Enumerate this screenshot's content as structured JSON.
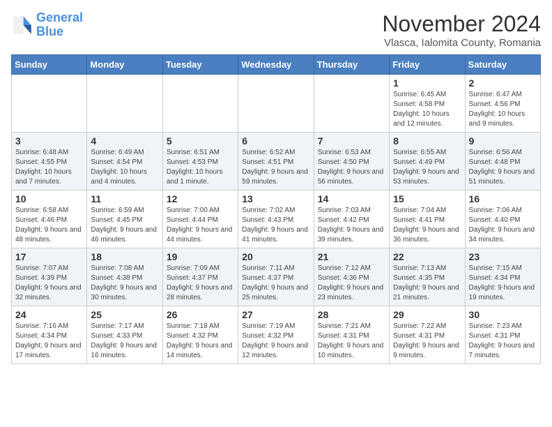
{
  "header": {
    "logo_line1": "General",
    "logo_line2": "Blue",
    "month_title": "November 2024",
    "subtitle": "Vlasca, Ialomita County, Romania"
  },
  "days_of_week": [
    "Sunday",
    "Monday",
    "Tuesday",
    "Wednesday",
    "Thursday",
    "Friday",
    "Saturday"
  ],
  "weeks": [
    [
      {
        "day": "",
        "info": ""
      },
      {
        "day": "",
        "info": ""
      },
      {
        "day": "",
        "info": ""
      },
      {
        "day": "",
        "info": ""
      },
      {
        "day": "",
        "info": ""
      },
      {
        "day": "1",
        "info": "Sunrise: 6:45 AM\nSunset: 4:58 PM\nDaylight: 10 hours and 12 minutes."
      },
      {
        "day": "2",
        "info": "Sunrise: 6:47 AM\nSunset: 4:56 PM\nDaylight: 10 hours and 9 minutes."
      }
    ],
    [
      {
        "day": "3",
        "info": "Sunrise: 6:48 AM\nSunset: 4:55 PM\nDaylight: 10 hours and 7 minutes."
      },
      {
        "day": "4",
        "info": "Sunrise: 6:49 AM\nSunset: 4:54 PM\nDaylight: 10 hours and 4 minutes."
      },
      {
        "day": "5",
        "info": "Sunrise: 6:51 AM\nSunset: 4:53 PM\nDaylight: 10 hours and 1 minute."
      },
      {
        "day": "6",
        "info": "Sunrise: 6:52 AM\nSunset: 4:51 PM\nDaylight: 9 hours and 59 minutes."
      },
      {
        "day": "7",
        "info": "Sunrise: 6:53 AM\nSunset: 4:50 PM\nDaylight: 9 hours and 56 minutes."
      },
      {
        "day": "8",
        "info": "Sunrise: 6:55 AM\nSunset: 4:49 PM\nDaylight: 9 hours and 53 minutes."
      },
      {
        "day": "9",
        "info": "Sunrise: 6:56 AM\nSunset: 4:48 PM\nDaylight: 9 hours and 51 minutes."
      }
    ],
    [
      {
        "day": "10",
        "info": "Sunrise: 6:58 AM\nSunset: 4:46 PM\nDaylight: 9 hours and 48 minutes."
      },
      {
        "day": "11",
        "info": "Sunrise: 6:59 AM\nSunset: 4:45 PM\nDaylight: 9 hours and 46 minutes."
      },
      {
        "day": "12",
        "info": "Sunrise: 7:00 AM\nSunset: 4:44 PM\nDaylight: 9 hours and 44 minutes."
      },
      {
        "day": "13",
        "info": "Sunrise: 7:02 AM\nSunset: 4:43 PM\nDaylight: 9 hours and 41 minutes."
      },
      {
        "day": "14",
        "info": "Sunrise: 7:03 AM\nSunset: 4:42 PM\nDaylight: 9 hours and 39 minutes."
      },
      {
        "day": "15",
        "info": "Sunrise: 7:04 AM\nSunset: 4:41 PM\nDaylight: 9 hours and 36 minutes."
      },
      {
        "day": "16",
        "info": "Sunrise: 7:06 AM\nSunset: 4:40 PM\nDaylight: 9 hours and 34 minutes."
      }
    ],
    [
      {
        "day": "17",
        "info": "Sunrise: 7:07 AM\nSunset: 4:39 PM\nDaylight: 9 hours and 32 minutes."
      },
      {
        "day": "18",
        "info": "Sunrise: 7:08 AM\nSunset: 4:38 PM\nDaylight: 9 hours and 30 minutes."
      },
      {
        "day": "19",
        "info": "Sunrise: 7:09 AM\nSunset: 4:37 PM\nDaylight: 9 hours and 28 minutes."
      },
      {
        "day": "20",
        "info": "Sunrise: 7:11 AM\nSunset: 4:37 PM\nDaylight: 9 hours and 25 minutes."
      },
      {
        "day": "21",
        "info": "Sunrise: 7:12 AM\nSunset: 4:36 PM\nDaylight: 9 hours and 23 minutes."
      },
      {
        "day": "22",
        "info": "Sunrise: 7:13 AM\nSunset: 4:35 PM\nDaylight: 9 hours and 21 minutes."
      },
      {
        "day": "23",
        "info": "Sunrise: 7:15 AM\nSunset: 4:34 PM\nDaylight: 9 hours and 19 minutes."
      }
    ],
    [
      {
        "day": "24",
        "info": "Sunrise: 7:16 AM\nSunset: 4:34 PM\nDaylight: 9 hours and 17 minutes."
      },
      {
        "day": "25",
        "info": "Sunrise: 7:17 AM\nSunset: 4:33 PM\nDaylight: 9 hours and 16 minutes."
      },
      {
        "day": "26",
        "info": "Sunrise: 7:18 AM\nSunset: 4:32 PM\nDaylight: 9 hours and 14 minutes."
      },
      {
        "day": "27",
        "info": "Sunrise: 7:19 AM\nSunset: 4:32 PM\nDaylight: 9 hours and 12 minutes."
      },
      {
        "day": "28",
        "info": "Sunrise: 7:21 AM\nSunset: 4:31 PM\nDaylight: 9 hours and 10 minutes."
      },
      {
        "day": "29",
        "info": "Sunrise: 7:22 AM\nSunset: 4:31 PM\nDaylight: 9 hours and 9 minutes."
      },
      {
        "day": "30",
        "info": "Sunrise: 7:23 AM\nSunset: 4:31 PM\nDaylight: 9 hours and 7 minutes."
      }
    ]
  ]
}
